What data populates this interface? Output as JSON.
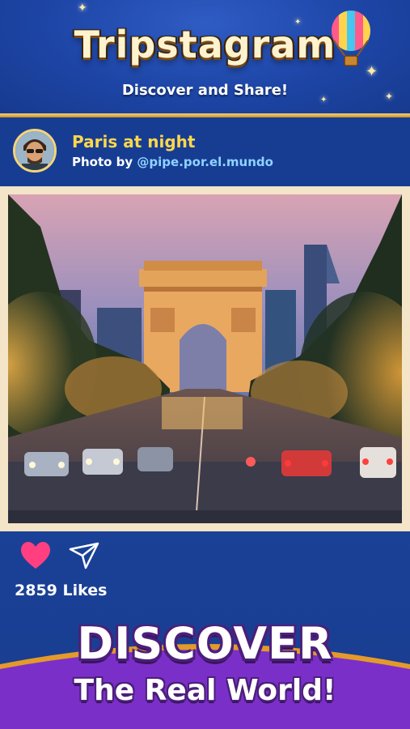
{
  "header": {
    "title": "Tripstagram",
    "subtitle": "Discover and Share!"
  },
  "post": {
    "title": "Paris at night",
    "credit_prefix": "Photo by ",
    "credit_handle": "@pipe.por.el.mundo",
    "photo_subject": "Arc de Triomphe, Champs-Élysées at night"
  },
  "actions": {
    "like_icon": "heart-icon",
    "share_icon": "send-icon",
    "likes_label": "2859 Likes"
  },
  "banner": {
    "headline": "DISCOVER",
    "tagline": "The Real World!"
  },
  "colors": {
    "header_blue": "#1d45a6",
    "gold": "#f5d47a",
    "title_yellow": "#ffd84a",
    "handle_blue": "#8fd3ff",
    "heart_pink": "#ff3f7f",
    "banner_purple": "#7b2fc9"
  }
}
